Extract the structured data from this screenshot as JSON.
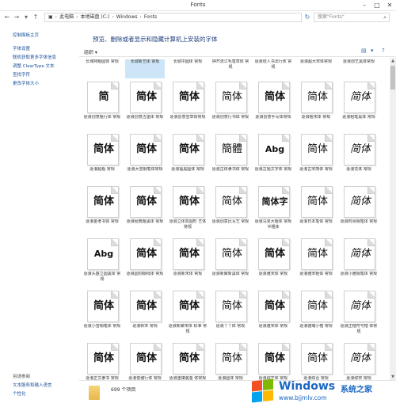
{
  "window": {
    "title": "Fonts"
  },
  "nav": {
    "path": [
      "此电脑",
      "本地磁盘 (C:)",
      "Windows",
      "Fonts"
    ],
    "search_placeholder": "搜索\"Fonts\""
  },
  "sidebar": {
    "links": [
      "控制面板主页",
      "字体设置",
      "联机获取更多字体信息",
      "调整 ClearType 文本",
      "查找字符",
      "更改字体大小"
    ],
    "see_also_header": "另请参阅",
    "see_also": [
      "文本服务和输入语言",
      "个性化"
    ]
  },
  "header": {
    "title": "预览、删除或者显示和隐藏计算机上安装的字体"
  },
  "toolbar": {
    "organize": "组织 ▾"
  },
  "top_row": [
    "长城特粗圆体 常规",
    "长城新艺体 常规",
    "长城中圆体 常规",
    "钟齐流江毛笔草体 常规",
    "逐浪佳人书法行体 常规",
    "逐浪超大宋体常规",
    "逐浪创艺黑体常规"
  ],
  "fonts": [
    {
      "sample": "简",
      "name": "逐浪创意粗行体 常规"
    },
    {
      "sample": "简体",
      "name": "逐浪创意古墨体 常规"
    },
    {
      "sample": "简体",
      "name": "逐浪创意宣草体常规"
    },
    {
      "sample": "简体",
      "name": "逐浪创意行书体 常规"
    },
    {
      "sample": "简体",
      "name": "逐浪创意手写体常规"
    },
    {
      "sample": "简体",
      "name": "逐浪粗宋体 常规"
    },
    {
      "sample": "简体",
      "name": "逐浪粗笔黑体 常规"
    },
    {
      "sample": "简体",
      "name": "逐浪超粗 常规"
    },
    {
      "sample": "简体",
      "name": "逐浪大雪钢笔体常规"
    },
    {
      "sample": "简体",
      "name": "逐浪福黑圆体 常规"
    },
    {
      "sample": "簡體",
      "name": "逐浪古体隶书体 常规"
    },
    {
      "sample": "Abg",
      "name": "逐浪古题文字体 常规"
    },
    {
      "sample": "简体",
      "name": "逐浪古宋简体 常规"
    },
    {
      "sample": "简体",
      "name": "逐浪花体 常规"
    },
    {
      "sample": "简体",
      "name": "逐浪金老书体 常规"
    },
    {
      "sample": "简体",
      "name": "逐浪经典粗黑体 常规"
    },
    {
      "sample": "简体",
      "name": "逐浪立体双圆形 艺体常规"
    },
    {
      "sample": "简体",
      "name": "逐浪创意比写艺 常规"
    },
    {
      "sample": "简体字",
      "name": "逐浪马克大粗体 常规 半粗体"
    },
    {
      "sample": "简体",
      "name": "逐浪日本笔体 常规"
    },
    {
      "sample": "简体",
      "name": "逐浪时尚钢笔体 常规"
    },
    {
      "sample": "Abg",
      "name": "逐浪头盔立圆黑体 常规"
    },
    {
      "sample": "简体",
      "name": "逐浪圆刻钢线体 常规"
    },
    {
      "sample": "简体",
      "name": "逐浪新宋体 常规"
    },
    {
      "sample": "简体",
      "name": "逐浪新聚新黑体 常规"
    },
    {
      "sample": "简体",
      "name": "逐浪雅宋体 常规"
    },
    {
      "sample": "简体",
      "name": "逐浪雅宋粗体 常规"
    },
    {
      "sample": "简体",
      "name": "逐浪小雅钢笔体 常规"
    },
    {
      "sample": "简体",
      "name": "逐浪小雪钢笔体 常规"
    },
    {
      "sample": "简体",
      "name": "逐浪新宋 常规"
    },
    {
      "sample": "简体",
      "name": "逐浪新聚宋体 标准 常规"
    },
    {
      "sample": "简体",
      "name": "逐浪丫丫体 常规"
    },
    {
      "sample": "简体",
      "name": "逐浪雅宋体 常规"
    },
    {
      "sample": "简体",
      "name": "逐浪雅瑞小楷 常规"
    },
    {
      "sample": "简体",
      "name": "逐浪正楷符号楷 体常规"
    },
    {
      "sample": "简体",
      "name": "逐浪正文隶书 常规"
    },
    {
      "sample": "简体",
      "name": "逐浪俊雅行体 常规"
    },
    {
      "sample": "简体",
      "name": "逐浪重镇装金 体常规"
    },
    {
      "sample": "简体",
      "name": "逐浪圆体 常规"
    },
    {
      "sample": "简体",
      "name": "逐浪综艺体 常规"
    },
    {
      "sample": "简体",
      "name": "逐浪综合 常规"
    },
    {
      "sample": "简体",
      "name": "逐浪综宋 常规"
    }
  ],
  "status": {
    "count": "699 个项目"
  },
  "watermark": {
    "brand": "Windows",
    "suffix": "系统之家",
    "url": "www.bjjmlv.com"
  }
}
